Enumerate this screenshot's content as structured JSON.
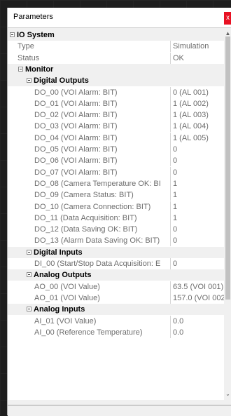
{
  "window": {
    "title": "Parameters",
    "close_glyph": "x"
  },
  "grid": {
    "rows": [
      {
        "type": "category",
        "level": 0,
        "name": "IO System"
      },
      {
        "type": "property",
        "level": 0,
        "name": "Type",
        "value": "Simulation"
      },
      {
        "type": "property",
        "level": 0,
        "name": "Status",
        "value": "OK"
      },
      {
        "type": "category",
        "level": 1,
        "name": "Monitor"
      },
      {
        "type": "category",
        "level": 2,
        "name": "Digital Outputs"
      },
      {
        "type": "property",
        "level": 2,
        "name": "DO_00 (VOI Alarm: BIT)",
        "value": "0 (AL 001)"
      },
      {
        "type": "property",
        "level": 2,
        "name": "DO_01 (VOI Alarm: BIT)",
        "value": "1 (AL 002)"
      },
      {
        "type": "property",
        "level": 2,
        "name": "DO_02 (VOI Alarm: BIT)",
        "value": "1 (AL 003)"
      },
      {
        "type": "property",
        "level": 2,
        "name": "DO_03 (VOI Alarm: BIT)",
        "value": "1 (AL 004)"
      },
      {
        "type": "property",
        "level": 2,
        "name": "DO_04 (VOI Alarm: BIT)",
        "value": "1 (AL 005)"
      },
      {
        "type": "property",
        "level": 2,
        "name": "DO_05 (VOI Alarm: BIT)",
        "value": "0"
      },
      {
        "type": "property",
        "level": 2,
        "name": "DO_06 (VOI Alarm: BIT)",
        "value": "0"
      },
      {
        "type": "property",
        "level": 2,
        "name": "DO_07 (VOI Alarm: BIT)",
        "value": "0"
      },
      {
        "type": "property",
        "level": 2,
        "name": "DO_08 (Camera Temperature OK: BI",
        "value": "1"
      },
      {
        "type": "property",
        "level": 2,
        "name": "DO_09 (Camera Status: BIT)",
        "value": "1"
      },
      {
        "type": "property",
        "level": 2,
        "name": "DO_10 (Camera Connection: BIT)",
        "value": "1"
      },
      {
        "type": "property",
        "level": 2,
        "name": "DO_11 (Data Acquisition: BIT)",
        "value": "1"
      },
      {
        "type": "property",
        "level": 2,
        "name": "DO_12 (Data Saving OK: BIT)",
        "value": "0"
      },
      {
        "type": "property",
        "level": 2,
        "name": "DO_13 (Alarm Data Saving OK: BIT)",
        "value": "0"
      },
      {
        "type": "category",
        "level": 2,
        "name": "Digital Inputs"
      },
      {
        "type": "property",
        "level": 2,
        "name": "DI_00 (Start/Stop Data Acquisition: E",
        "value": "0"
      },
      {
        "type": "category",
        "level": 2,
        "name": "Analog Outputs"
      },
      {
        "type": "property",
        "level": 2,
        "name": "AO_00 (VOI Value)",
        "value": "63.5 (VOI 001)"
      },
      {
        "type": "property",
        "level": 2,
        "name": "AO_01 (VOI Value)",
        "value": "157.0 (VOI 002)"
      },
      {
        "type": "category",
        "level": 2,
        "name": "Analog Inputs"
      },
      {
        "type": "property",
        "level": 2,
        "name": "AI_01 (VOI Value)",
        "value": "0.0"
      },
      {
        "type": "property",
        "level": 2,
        "name": "AI_00 (Reference Temperature)",
        "value": "0.0"
      }
    ]
  },
  "scrollbar": {
    "up_glyph": "▲",
    "down_glyph": "⌄"
  },
  "icons": {
    "expander": "minus-box-icon"
  }
}
